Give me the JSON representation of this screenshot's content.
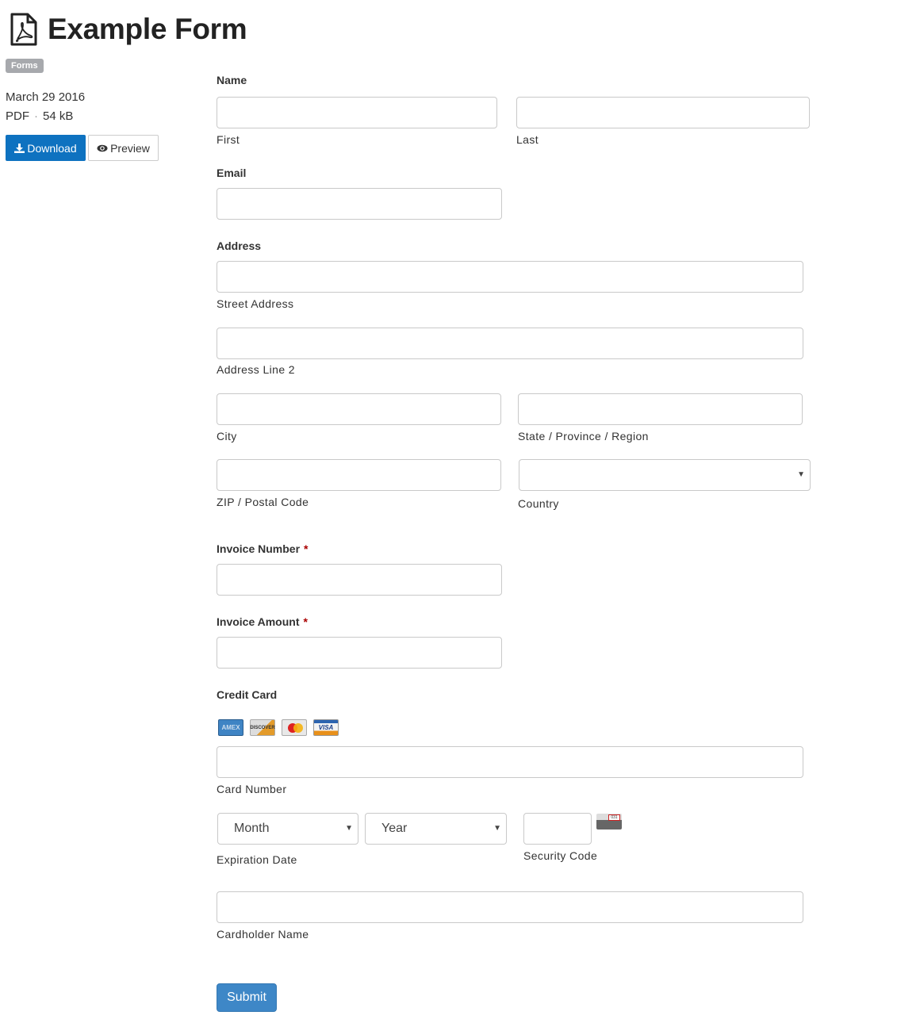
{
  "header": {
    "title": "Example Form",
    "icon": "pdf-file-icon"
  },
  "sidebar": {
    "tag": "Forms",
    "date": "March 29 2016",
    "file_type": "PDF",
    "separator": "·",
    "file_size": "54 kB",
    "download_label": "Download",
    "preview_label": "Preview"
  },
  "form": {
    "name": {
      "label": "Name",
      "first": "First",
      "last": "Last",
      "first_value": "",
      "last_value": ""
    },
    "email": {
      "label": "Email",
      "value": ""
    },
    "address": {
      "label": "Address",
      "street": "Street Address",
      "line2": "Address Line 2",
      "city": "City",
      "state": "State / Province / Region",
      "zip": "ZIP / Postal Code",
      "country": "Country",
      "country_value": ""
    },
    "invoice_number": {
      "label": "Invoice Number",
      "required": "*",
      "value": ""
    },
    "invoice_amount": {
      "label": "Invoice Amount",
      "required": "*",
      "value": ""
    },
    "credit_card": {
      "label": "Credit Card",
      "card_types": [
        "AMEX",
        "DISCOVER",
        "MasterCard",
        "VISA"
      ],
      "card_number": "Card Number",
      "month": "Month",
      "year": "Year",
      "expiration": "Expiration Date",
      "security_code": "Security Code",
      "cvv_sample": "031",
      "cardholder": "Cardholder Name"
    },
    "submit_label": "Submit"
  },
  "colors": {
    "primary": "#0e72c0",
    "submit": "#3e87c7",
    "required": "#aa0000",
    "tag": "#a7a9ad"
  }
}
